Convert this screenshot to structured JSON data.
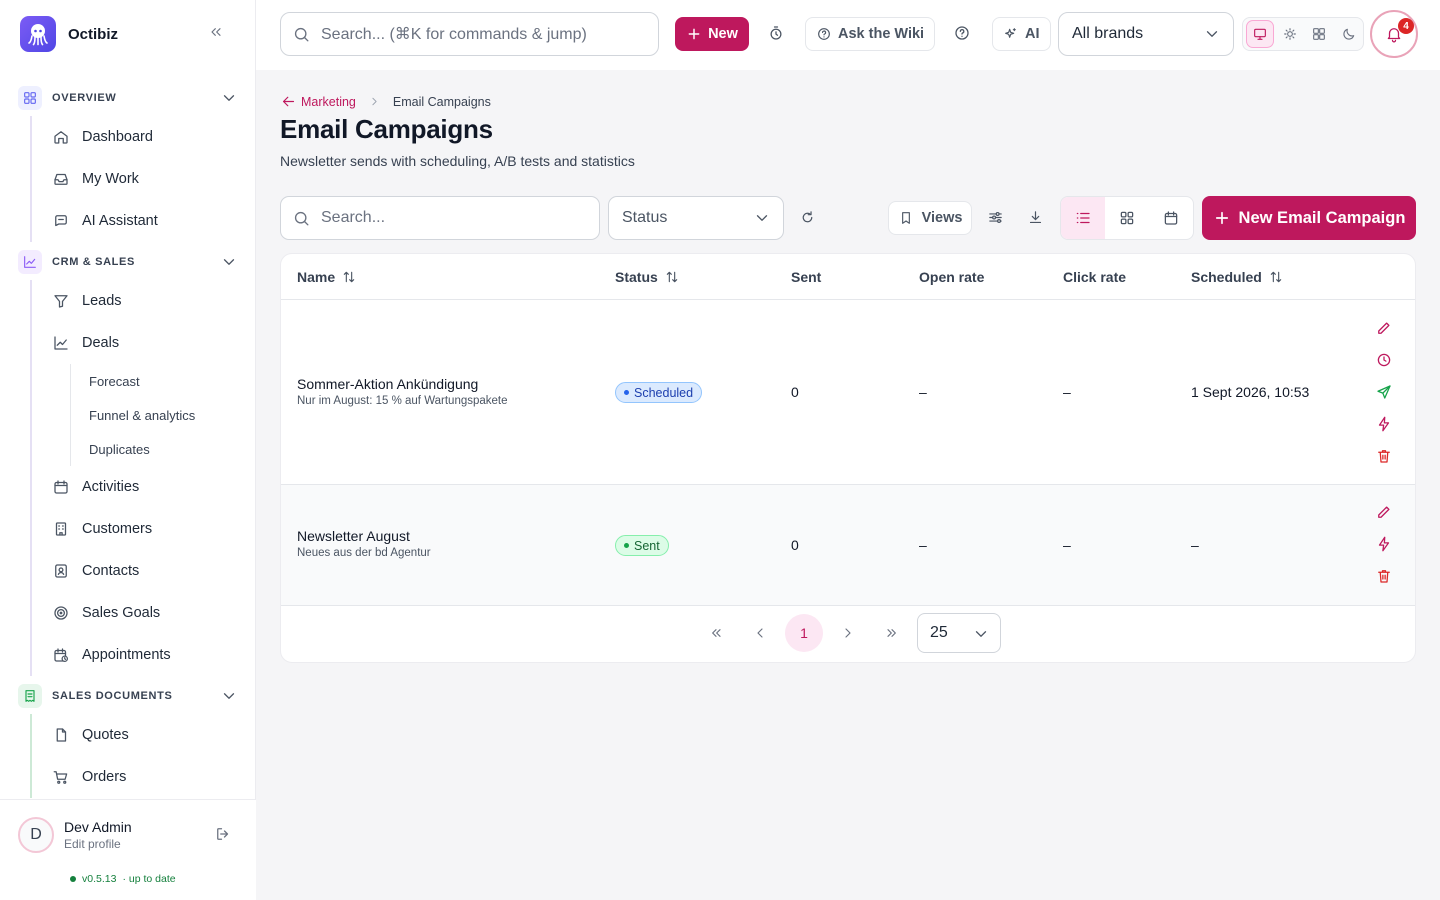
{
  "app": {
    "name": "Octibiz",
    "accent": "#be185d",
    "logo_icon": "octopus-logo-icon"
  },
  "sidebar": {
    "sections": [
      {
        "label": "OVERVIEW",
        "icon": "grid-icon",
        "items": [
          "Dashboard",
          "My Work",
          "AI Assistant"
        ]
      },
      {
        "label": "CRM & SALES",
        "icon": "trend-chart-icon",
        "items": [
          "Leads",
          "Deals",
          "Activities",
          "Customers",
          "Contacts",
          "Sales Goals",
          "Appointments"
        ],
        "deal_subitems": [
          "Forecast",
          "Funnel & analytics",
          "Duplicates"
        ]
      },
      {
        "label": "SALES DOCUMENTS",
        "icon": "receipt-icon",
        "items": [
          "Quotes",
          "Orders"
        ]
      }
    ],
    "user": {
      "initial": "D",
      "name": "Dev Admin",
      "sub": "Edit profile"
    },
    "version": "v0.5.13",
    "version_status": "· up to date"
  },
  "topbar": {
    "search_placeholder": "Search... (⌘K for commands & jump)",
    "new_label": "New",
    "wiki_label": "Ask the Wiki",
    "ai_label": "AI",
    "brand_select": "All brands",
    "notifications": "4"
  },
  "breadcrumb": {
    "parent": "Marketing",
    "current": "Email Campaigns"
  },
  "page": {
    "title": "Email Campaigns",
    "subtitle": "Newsletter sends with scheduling, A/B tests and statistics"
  },
  "toolbar": {
    "search_placeholder": "Search...",
    "status_placeholder": "Status",
    "views_label": "Views",
    "new_campaign_label": "New Email Campaign"
  },
  "table": {
    "columns": {
      "name": "Name",
      "status": "Status",
      "sent": "Sent",
      "open_rate": "Open rate",
      "click_rate": "Click rate",
      "scheduled": "Scheduled"
    },
    "rows": [
      {
        "name": "Sommer-Aktion Ankündigung",
        "description": "Nur im August: 15 % auf Wartungspakete",
        "status": "Scheduled",
        "sent": "0",
        "open_rate": "–",
        "click_rate": "–",
        "scheduled": "1 Sept 2026, 10:53"
      },
      {
        "name": "Newsletter August",
        "description": "Neues aus der bd Agentur",
        "status": "Sent",
        "sent": "0",
        "open_rate": "–",
        "click_rate": "–",
        "scheduled": "–"
      }
    ]
  },
  "pagination": {
    "current_page": "1",
    "page_size": "25"
  }
}
